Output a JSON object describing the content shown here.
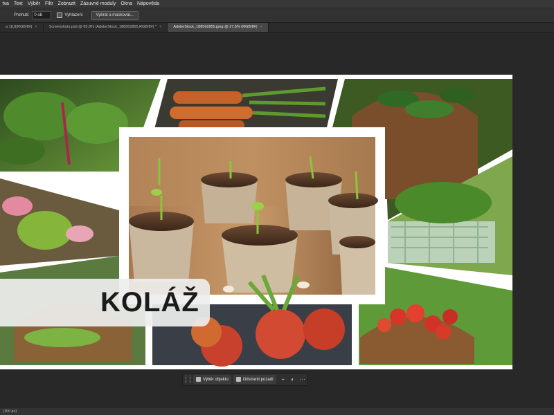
{
  "menu": [
    "tva",
    "Text",
    "Výběr",
    "Filtr",
    "Zobrazit",
    "Zásuvné moduly",
    "Okna",
    "Nápověda"
  ],
  "options": {
    "feather_label": "Prolnutí:",
    "feather_value": "0 ob",
    "antialias_label": "Vyhlazení",
    "select_mask_button": "Vybrat a maskovat..."
  },
  "tabs": [
    {
      "label": "a 18,8(RGB/8#)",
      "close": "×",
      "active": false
    },
    {
      "label": "Screenshots.psd @ 65,9% (AdobeStock_188562855,RGB/8#) *",
      "close": "×",
      "active": false
    },
    {
      "label": "AdobeStock_188562855.jpeg @ 27,5% (RGB/8#)",
      "close": "×",
      "active": true
    }
  ],
  "collage": {
    "title": "KOLÁŽ"
  },
  "context_toolbar": {
    "select_subject": "Výběr objektu",
    "remove_background": "Odstranit pozadí",
    "more": "···"
  },
  "status": {
    "zoom": "(100 px)"
  },
  "colors": {
    "app_bg": "#282828",
    "menubar": "#383838",
    "active_tab": "#474747"
  }
}
